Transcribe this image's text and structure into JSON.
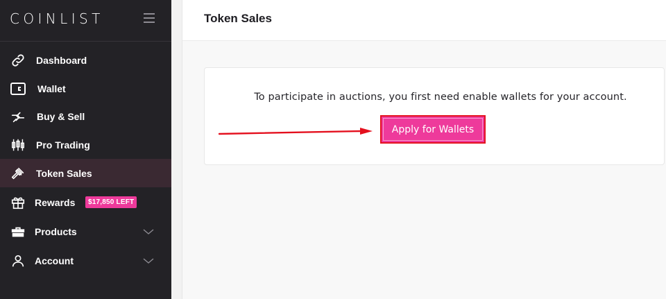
{
  "sidebar": {
    "brand": "COINLIST",
    "items": [
      {
        "label": "Dashboard",
        "icon": "link-icon"
      },
      {
        "label": "Wallet",
        "icon": "wallet-icon"
      },
      {
        "label": "Buy & Sell",
        "icon": "swap-arrows-icon"
      },
      {
        "label": "Pro Trading",
        "icon": "candlestick-icon"
      },
      {
        "label": "Token Sales",
        "icon": "gavel-icon",
        "active": true
      },
      {
        "label": "Rewards",
        "icon": "gift-icon",
        "badge": "$17,850 LEFT"
      },
      {
        "label": "Products",
        "icon": "briefcase-icon",
        "expandable": true
      },
      {
        "label": "Account",
        "icon": "user-icon",
        "expandable": true
      }
    ]
  },
  "header": {
    "title": "Token Sales"
  },
  "main": {
    "message": "To participate in auctions, you first need enable wallets for your account.",
    "apply_button": "Apply for Wallets"
  },
  "colors": {
    "sidebar_bg": "#232226",
    "active_bg": "#3a2932",
    "accent": "#ee3a9b",
    "annotation_red": "#e4101e"
  }
}
